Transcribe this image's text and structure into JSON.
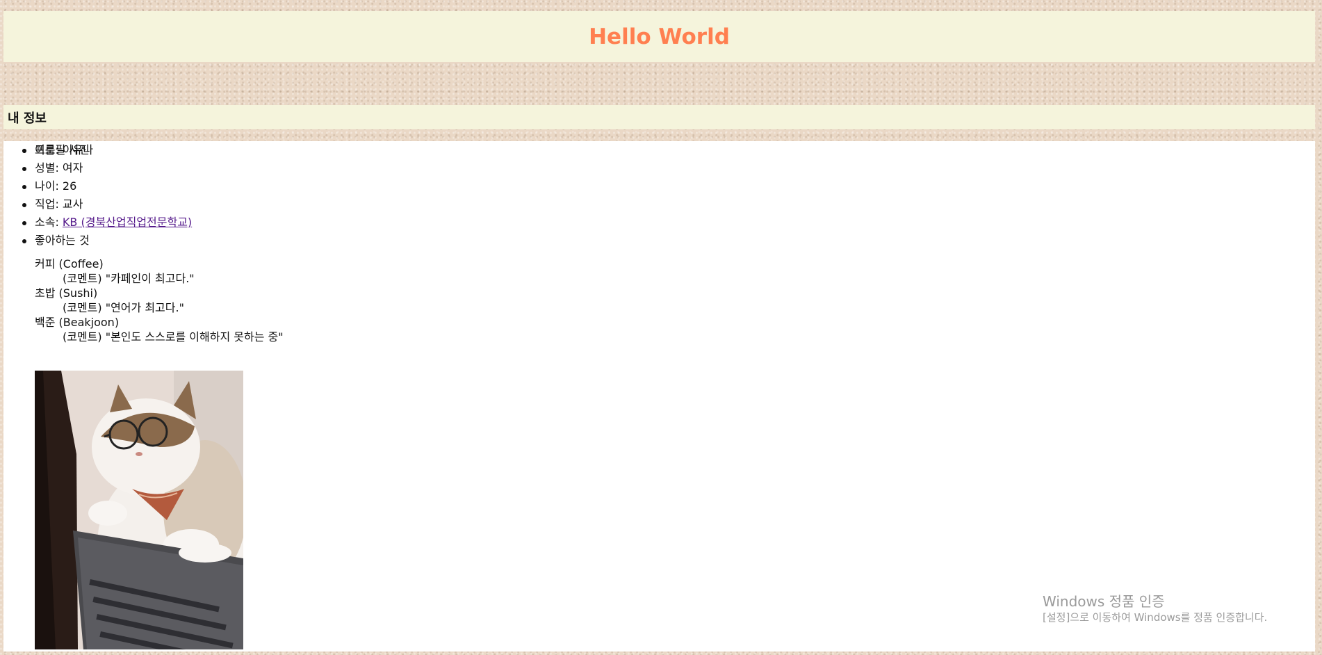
{
  "header": {
    "title": "Hello World",
    "title_color": "#ff7f50"
  },
  "section": {
    "title": "내 정보"
  },
  "info": {
    "name": "이름: 이유나",
    "gender": "성별: 여자",
    "age": "나이: 26",
    "job": "직업: 교사",
    "affiliation_label": "소속: ",
    "affiliation_link": "KB (경북산업직업전문학교)",
    "likes_label": "좋아하는 것",
    "profile_label": "프로필 사진"
  },
  "likes": [
    {
      "item": "커피 (Coffee)",
      "comment": "(코멘트) \"카페인이 최고다.\""
    },
    {
      "item": "초밥 (Sushi)",
      "comment": "(코멘트) \"연어가 최고다.\""
    },
    {
      "item": "백준 (Beakjoon)",
      "comment": "(코멘트) \"본인도 스스로를 이해하지 못하는 중\""
    }
  ],
  "photo": {
    "icon": "cat-with-glasses-at-laptop-image"
  },
  "watermark": {
    "line1": "Windows 정품 인증",
    "line2": "[설정]으로 이동하여 Windows를 정품 인증합니다."
  }
}
